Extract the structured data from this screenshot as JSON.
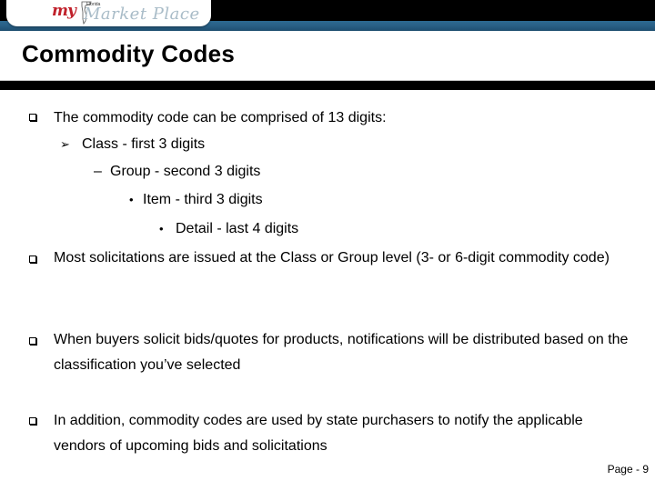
{
  "header": {
    "logo": {
      "my": "my",
      "florida": "Florida",
      "marketplace": "Market Place"
    },
    "colors": {
      "top_bar": "#000000",
      "blue_band": "#285f85",
      "logo_red": "#c0202a",
      "logo_gray": "#a9bcc8"
    }
  },
  "title": "Commodity Codes",
  "bullets": [
    {
      "text": "The commodity code can be comprised of 13 digits:",
      "children": [
        {
          "icon": "arrow-bullet",
          "text": "Class - first 3 digits"
        },
        {
          "icon": "dash-bullet",
          "text": "Group - second 3 digits"
        },
        {
          "icon": "dot-bullet",
          "text": "Item - third 3 digits"
        },
        {
          "icon": "dot-bullet",
          "text": "Detail - last 4 digits"
        }
      ]
    },
    {
      "text": "Most solicitations are issued at the Class or Group level (3- or 6-digit commodity code)"
    },
    {
      "text": "When buyers solicit bids/quotes for products, notifications will be distributed based on the classification you’ve selected"
    },
    {
      "text": "In addition, commodity codes are used by state purchasers to notify the applicable vendors of upcoming bids and solicitations"
    }
  ],
  "glyphs": {
    "arrow": "➢",
    "dash": "–",
    "dot": "•"
  },
  "footer": {
    "page_label": "Page - 9"
  }
}
